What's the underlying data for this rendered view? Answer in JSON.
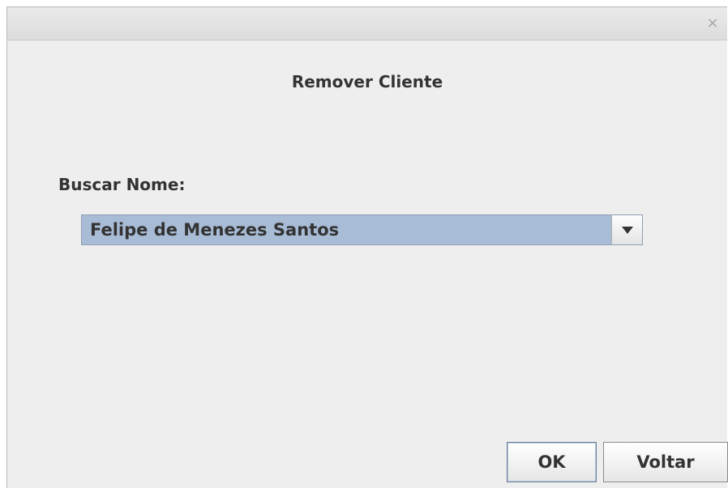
{
  "window": {
    "close_icon": "close-icon",
    "close_glyph": "×"
  },
  "dialog": {
    "title": "Remover Cliente",
    "search_label": "Buscar Nome:",
    "combo": {
      "selected_value": "Felipe de Menezes Santos",
      "arrow_icon": "chevron-down-icon",
      "highlight_color": "#a8bcd6"
    },
    "buttons": {
      "ok_label": "OK",
      "back_label": "Voltar"
    }
  }
}
